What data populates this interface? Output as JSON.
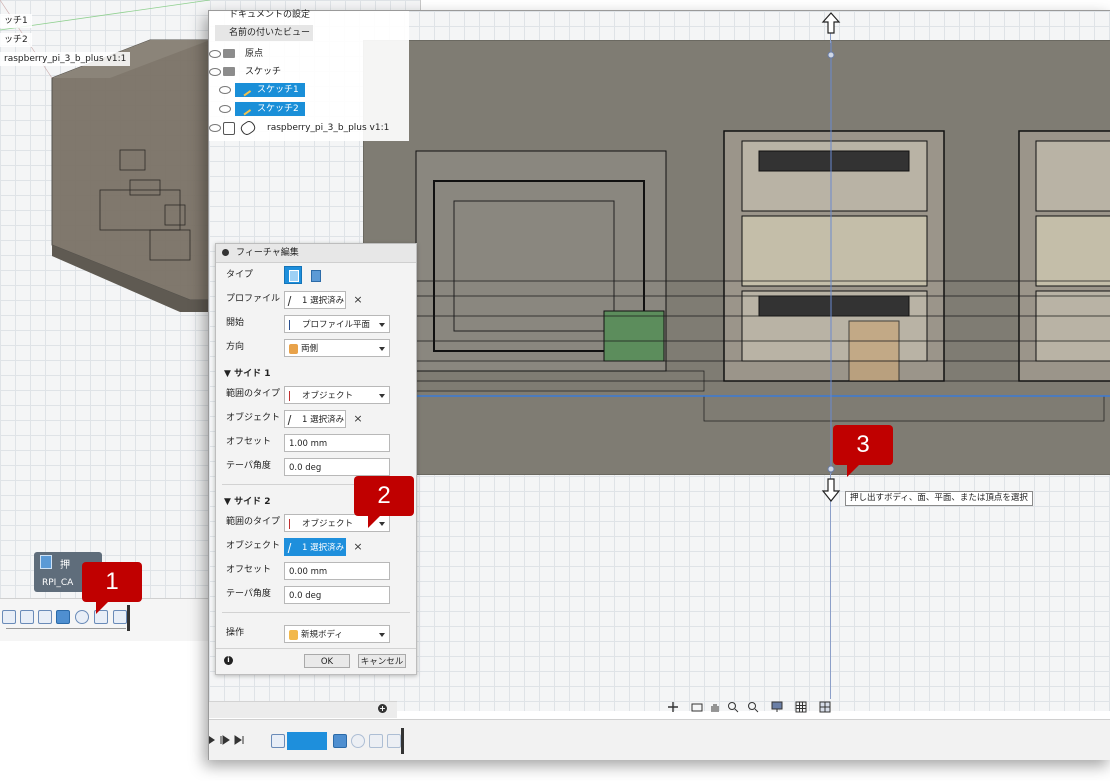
{
  "back_window": {
    "browser_items": [
      "ッチ1",
      "ッチ2",
      "raspberry_pi_3_b_plus v1:1"
    ],
    "tooltip": {
      "title": "押",
      "subtitle": "RPI_CA"
    }
  },
  "browser": {
    "items": [
      {
        "label": "ドキュメントの設定"
      },
      {
        "label": "名前の付いたビュー"
      },
      {
        "label": "原点"
      },
      {
        "label": "スケッチ"
      },
      {
        "label": "スケッチ1",
        "selected": true
      },
      {
        "label": "スケッチ2",
        "selected": true
      },
      {
        "label": "raspberry_pi_3_b_plus v1:1"
      }
    ]
  },
  "dialog": {
    "title": "フィーチャ編集",
    "labels": {
      "type": "タイプ",
      "profile": "プロファイル",
      "start": "開始",
      "direction": "方向",
      "side1": "サイド 1",
      "extent1": "範囲のタイプ",
      "object1": "オブジェクト",
      "offset1": "オフセット",
      "taper1": "テーパ角度",
      "side2": "サイド 2",
      "extent2": "範囲のタイプ",
      "object2": "オブジェクト",
      "offset2": "オフセット",
      "taper2": "テーパ角度",
      "operation": "操作"
    },
    "values": {
      "profile": "1 選択済み",
      "start": "プロファイル平面",
      "direction": "両側",
      "extent1": "オブジェクト",
      "object1": "1 選択済み",
      "offset1": "1.00 mm",
      "taper1": "0.0 deg",
      "extent2": "オブジェクト",
      "object2": "1 選択済み",
      "offset2": "0.00 mm",
      "taper2": "0.0 deg",
      "operation": "新規ボディ"
    },
    "ok": "OK",
    "cancel": "キャンセル"
  },
  "callouts": [
    "1",
    "2",
    "3"
  ],
  "tooltip_select": "押し出すボディ、面、平面、または頂点を選択",
  "colors": {
    "selection_blue": "#1e8fdc",
    "callout_red": "#c00000",
    "model_gray": "#7f7c73"
  }
}
